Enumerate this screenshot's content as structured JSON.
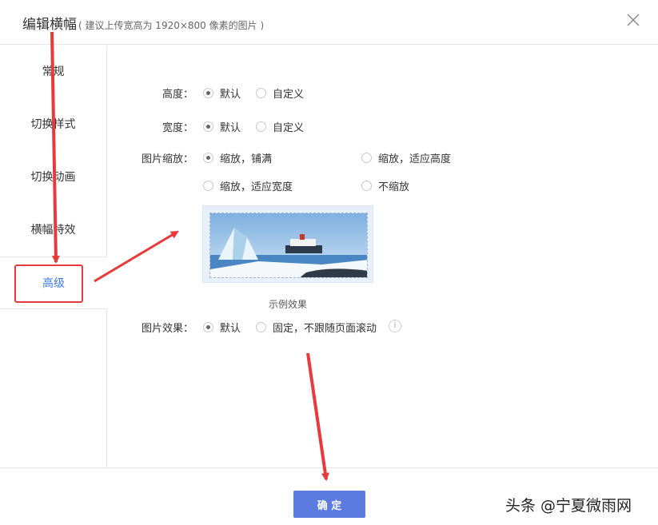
{
  "dialog": {
    "title": "编辑横幅",
    "subtitle": "( 建议上传宽高为 1920×800 像素的图片 )"
  },
  "sidebar": {
    "items": [
      {
        "label": "常规"
      },
      {
        "label": "切换样式"
      },
      {
        "label": "切换动画"
      },
      {
        "label": "横幅特效"
      },
      {
        "label": "高级"
      }
    ],
    "active": "高级"
  },
  "form": {
    "height": {
      "label": "高度：",
      "options": [
        "默认",
        "自定义"
      ],
      "selected": "默认"
    },
    "width": {
      "label": "宽度：",
      "options": [
        "默认",
        "自定义"
      ],
      "selected": "默认"
    },
    "image_scale": {
      "label": "图片缩放：",
      "options": [
        "缩放，铺满",
        "缩放，适应高度",
        "缩放，适应宽度",
        "不缩放"
      ],
      "selected": "缩放，铺满"
    },
    "preview_caption": "示例效果",
    "image_effect": {
      "label": "图片效果：",
      "options": [
        "默认",
        "固定，不跟随页面滚动"
      ],
      "selected": "默认",
      "info_icon": "i"
    }
  },
  "footer": {
    "ok_label": "确 定",
    "watermark": "头条 @宁夏微雨网"
  },
  "colors": {
    "accent": "#3b7be6",
    "button": "#5b7be0",
    "annotation": "#e83a3a"
  }
}
